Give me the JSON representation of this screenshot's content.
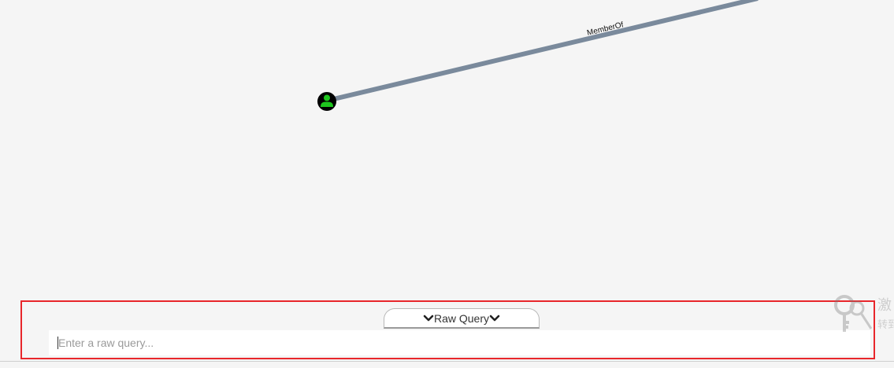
{
  "graph": {
    "edge": {
      "label": "MemberOf",
      "color": "#7a8a9c"
    },
    "node": {
      "icon": "user-icon",
      "fill": "#000000",
      "icon_color": "#1ec51e"
    }
  },
  "raw_query": {
    "toggle_label": "Raw Query",
    "placeholder": "Enter a raw query...",
    "value": ""
  },
  "highlight_color": "#e8262b",
  "watermark": {
    "main": "激",
    "sub": "转到"
  }
}
